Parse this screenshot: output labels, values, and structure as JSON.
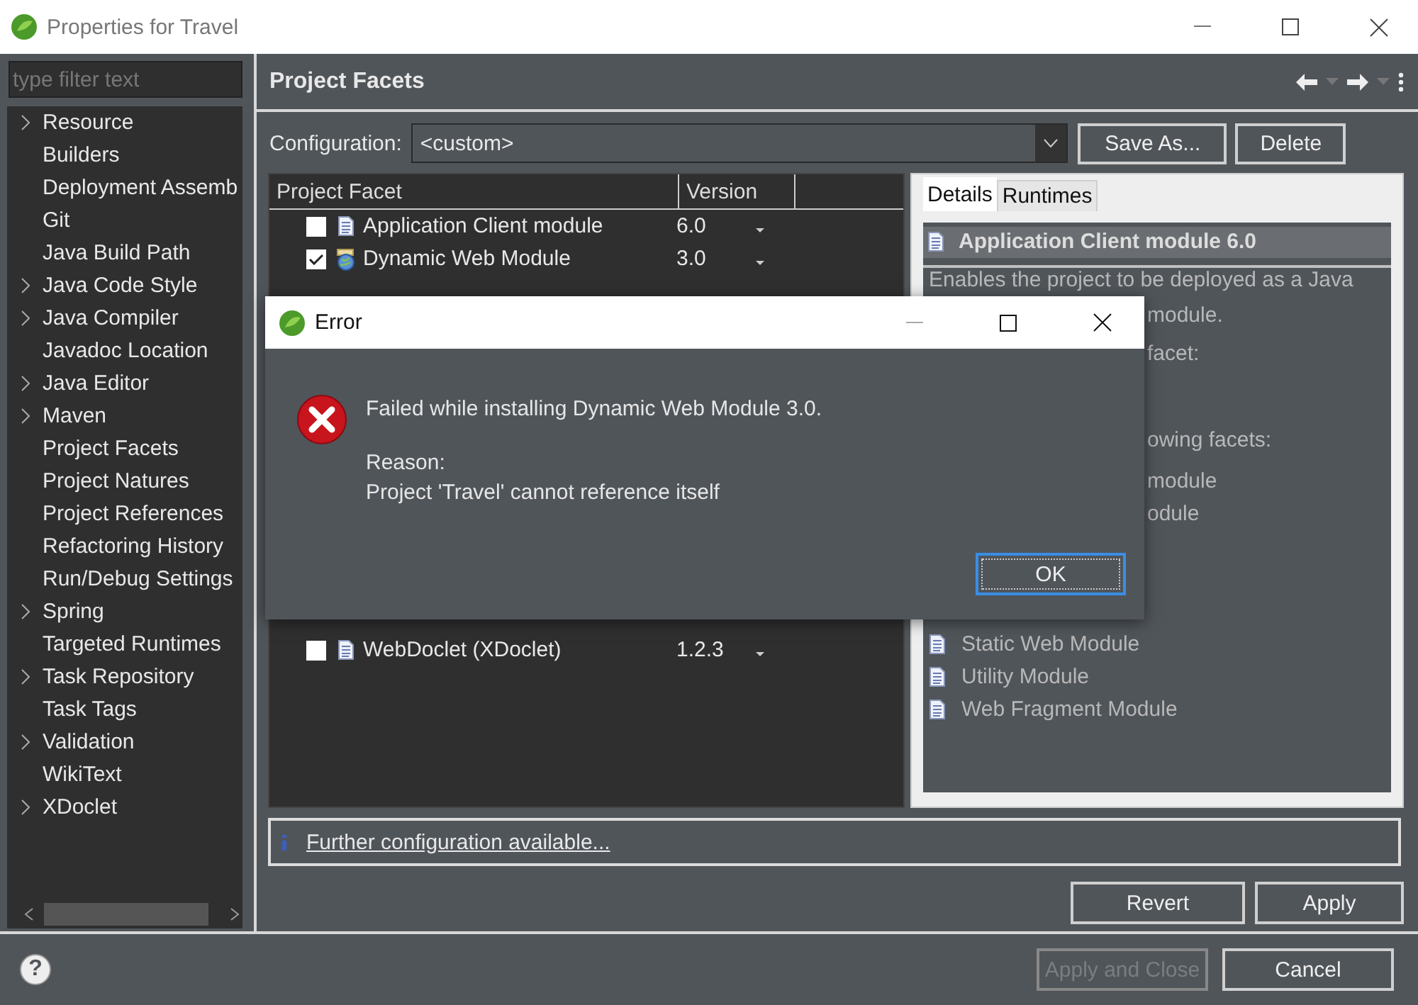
{
  "window": {
    "title": "Properties for Travel"
  },
  "filter": {
    "placeholder": "type filter text"
  },
  "sidebar": {
    "items": [
      {
        "label": "Resource",
        "expandable": true
      },
      {
        "label": "Builders",
        "expandable": false
      },
      {
        "label": "Deployment Assemb",
        "expandable": false
      },
      {
        "label": "Git",
        "expandable": false
      },
      {
        "label": "Java Build Path",
        "expandable": false
      },
      {
        "label": "Java Code Style",
        "expandable": true
      },
      {
        "label": "Java Compiler",
        "expandable": true
      },
      {
        "label": "Javadoc Location",
        "expandable": false
      },
      {
        "label": "Java Editor",
        "expandable": true
      },
      {
        "label": "Maven",
        "expandable": true
      },
      {
        "label": "Project Facets",
        "expandable": false
      },
      {
        "label": "Project Natures",
        "expandable": false
      },
      {
        "label": "Project References",
        "expandable": false
      },
      {
        "label": "Refactoring History",
        "expandable": false
      },
      {
        "label": "Run/Debug Settings",
        "expandable": false
      },
      {
        "label": "Spring",
        "expandable": true
      },
      {
        "label": "Targeted Runtimes",
        "expandable": false
      },
      {
        "label": "Task Repository",
        "expandable": true
      },
      {
        "label": "Task Tags",
        "expandable": false
      },
      {
        "label": "Validation",
        "expandable": true
      },
      {
        "label": "WikiText",
        "expandable": false
      },
      {
        "label": "XDoclet",
        "expandable": true
      }
    ]
  },
  "page": {
    "title": "Project Facets"
  },
  "configuration": {
    "label": "Configuration:",
    "value": "<custom>"
  },
  "config_buttons": [
    "Save As...",
    "Delete"
  ],
  "facets_table": {
    "columns": [
      "Project Facet",
      "Version"
    ],
    "rows": [
      {
        "name": "Application Client module",
        "version": "6.0",
        "checked": false,
        "kind": "document"
      },
      {
        "name": "Dynamic Web Module",
        "version": "3.0",
        "checked": true,
        "kind": "web"
      },
      {
        "name": "WebDoclet (XDoclet)",
        "version": "1.2.3",
        "checked": false,
        "kind": "document"
      }
    ]
  },
  "details": {
    "tabs": [
      {
        "label": "Details",
        "selected": true
      },
      {
        "label": "Runtimes",
        "selected": false
      }
    ],
    "heading": "Application Client module 6.0",
    "lines": [
      {
        "kind": "text",
        "text": "Enables the project to be deployed as a Java"
      },
      {
        "kind": "fragment",
        "text": "module."
      },
      {
        "kind": "fragment",
        "text": "facet:"
      },
      {
        "kind": "fragment",
        "text": "owing facets:"
      },
      {
        "kind": "fragment",
        "text": "module"
      },
      {
        "kind": "fragment",
        "text": "odule"
      },
      {
        "kind": "facet",
        "text": "Static Web Module"
      },
      {
        "kind": "facet",
        "text": "Utility Module"
      },
      {
        "kind": "facet",
        "text": "Web Fragment Module"
      }
    ]
  },
  "info_link": "Further configuration available...",
  "page_buttons": [
    "Revert",
    "Apply"
  ],
  "help_button": "?",
  "footer_buttons": [
    {
      "label": "Apply and Close",
      "disabled": true
    },
    {
      "label": "Cancel",
      "disabled": false
    }
  ],
  "dialog": {
    "title": "Error",
    "message": "Failed while installing Dynamic Web Module 3.0.",
    "reason_label": "Reason:",
    "reason": "Project 'Travel' cannot reference itself",
    "button": "OK"
  }
}
